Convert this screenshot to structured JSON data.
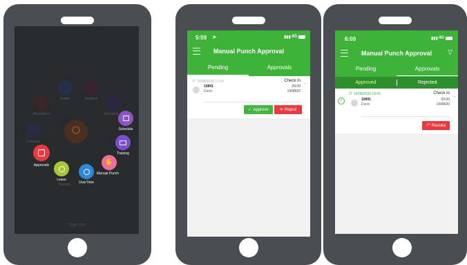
{
  "phone1": {
    "dim_items": [
      {
        "label": "Profile"
      },
      {
        "label": "Request"
      },
      {
        "label": "Attendance"
      },
      {
        "label": "Schedule"
      },
      {
        "label": "Contacts"
      },
      {
        "label": "Reports"
      }
    ],
    "menu": [
      {
        "label": "Schedule",
        "color": "#8e54c7",
        "icon": "calendar-icon"
      },
      {
        "label": "Training",
        "color": "#7a4fd1",
        "icon": "training-icon"
      },
      {
        "label": "Manual Punch",
        "color": "#ec6f9b",
        "icon": "hand-icon"
      },
      {
        "label": "OverTime",
        "color": "#2d88d8",
        "icon": "overtime-icon"
      },
      {
        "label": "Leave",
        "color": "#a9c63a",
        "icon": "leave-icon"
      },
      {
        "label": "Approvals",
        "color": "#e83a3f",
        "icon": "approvals-icon"
      }
    ],
    "bottom_text": "Sign out"
  },
  "phone2": {
    "status_time": "5:59",
    "status_right": "4G",
    "title": "Manual Punch Approval",
    "tabs": [
      "Pending",
      "Approvals"
    ],
    "item": {
      "timestamp": "14/08/2020 17:54",
      "check_label": "Check In",
      "id": "10891",
      "name": "Davis",
      "time": "09:00",
      "date": "14/08/20"
    },
    "approve_label": "Approve",
    "reject_label": "Reject"
  },
  "phone3": {
    "status_time": "6:00",
    "status_right": "4G",
    "title": "Manual Punch Approval",
    "tabs": [
      "Pending",
      "Approvals"
    ],
    "subtabs": [
      "Approved",
      "Rejected"
    ],
    "item": {
      "timestamp": "14/08/2020 18:00",
      "check_label": "Check In",
      "id": "10891",
      "name": "Davis",
      "time": "09:00",
      "date": "14/08/20"
    },
    "revoke_label": "Revoke"
  },
  "colors": {
    "green": "#3fb23a",
    "dark_green": "#2f8f2c",
    "red": "#e83a3f",
    "approve": "#46b443"
  }
}
